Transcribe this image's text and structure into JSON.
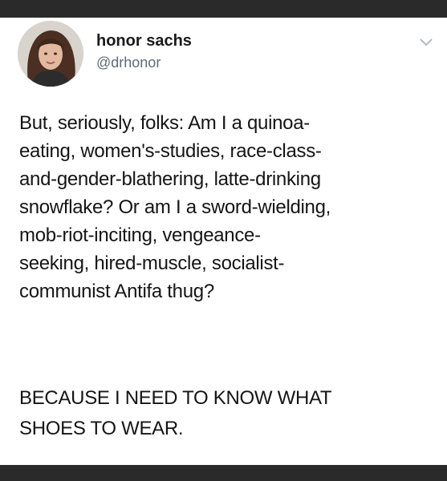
{
  "tweet": {
    "author_name": "honor sachs",
    "author_handle": "@drhonor",
    "body_paragraph_1": "But, seriously, folks: Am I a quinoa-\neating, women's-studies, race-class-\nand-gender-blathering, latte-drinking\nsnowflake? Or am I a sword-wielding,\nmob-riot-inciting, vengeance-\nseeking, hired-muscle, socialist-\ncommunist Antifa thug?",
    "body_paragraph_2": "BECAUSE I NEED TO KNOW WHAT\nSHOES TO WEAR."
  },
  "icons": {
    "avatar": "profile-photo",
    "menu": "chevron-down-icon"
  },
  "colors": {
    "background": "#ffffff",
    "frame": "#2a2a2a",
    "text": "#151515",
    "handle": "#5f6b75",
    "chevron": "#aab4bd"
  }
}
